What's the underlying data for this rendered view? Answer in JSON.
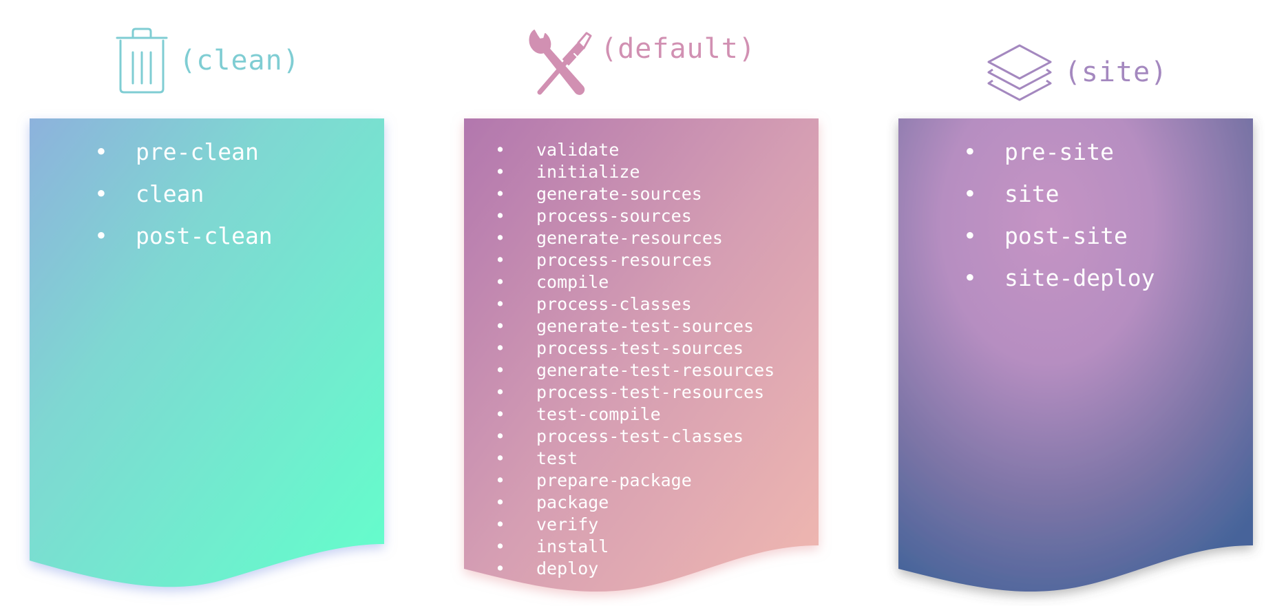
{
  "lifecycles": [
    {
      "title": "(clean)",
      "icon": "trash-icon",
      "accent_color": "#7fcdd3",
      "phases": [
        "pre-clean",
        "clean",
        "post-clean"
      ]
    },
    {
      "title": "(default)",
      "icon": "wrench-screwdriver-icon",
      "accent_color": "#d190b2",
      "phases": [
        "validate",
        "initialize",
        "generate-sources",
        "process-sources",
        "generate-resources",
        "process-resources",
        "compile",
        "process-classes",
        "generate-test-sources",
        "process-test-sources",
        "generate-test-resources",
        "process-test-resources",
        "test-compile",
        "process-test-classes",
        "test",
        "prepare-package",
        "package",
        "verify",
        "install",
        "deploy"
      ]
    },
    {
      "title": "(site)",
      "icon": "layers-icon",
      "accent_color": "#a488bf",
      "phases": [
        "pre-site",
        "site",
        "post-site",
        "site-deploy"
      ]
    }
  ]
}
